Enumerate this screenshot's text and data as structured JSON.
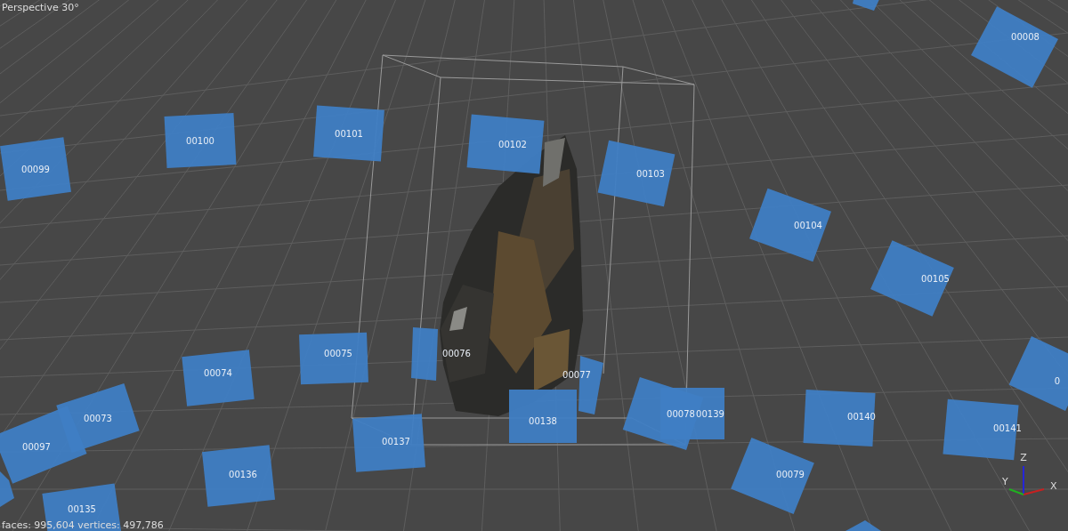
{
  "viewport": {
    "projection_label": "Perspective 30°",
    "stats": "faces: 995,604 vertices: 497,786"
  },
  "cameras": [
    {
      "label": "00099"
    },
    {
      "label": "00100"
    },
    {
      "label": "00101"
    },
    {
      "label": "00102"
    },
    {
      "label": "00103"
    },
    {
      "label": "00104"
    },
    {
      "label": "00105"
    },
    {
      "label": "00008"
    },
    {
      "label": "0"
    },
    {
      "label": "00075"
    },
    {
      "label": "00074"
    },
    {
      "label": "00076"
    },
    {
      "label": "00077"
    },
    {
      "label": "00073"
    },
    {
      "label": "00097"
    },
    {
      "label": "00137"
    },
    {
      "label": "00138"
    },
    {
      "label": "00078"
    },
    {
      "label": "00139"
    },
    {
      "label": "00140"
    },
    {
      "label": "00141"
    },
    {
      "label": "00079"
    },
    {
      "label": "00136"
    },
    {
      "label": "00135"
    }
  ],
  "axes": {
    "x": "X",
    "y": "Y",
    "z": "Z"
  }
}
